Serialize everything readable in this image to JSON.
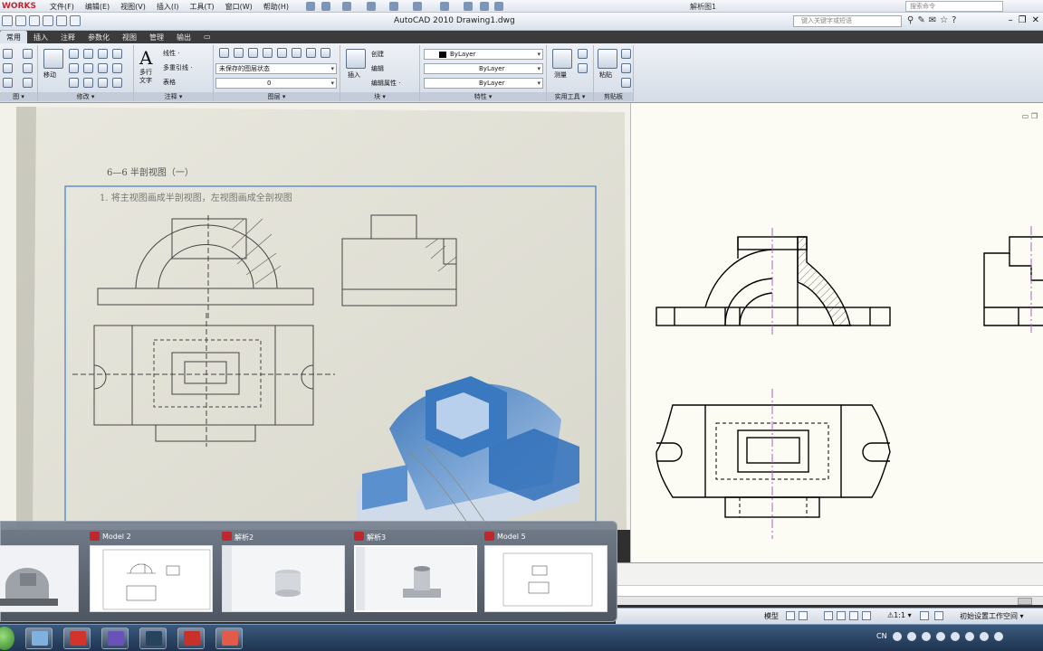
{
  "sw_menu": {
    "brand": "WORKS",
    "items": [
      "文件(F)",
      "编辑(E)",
      "视图(V)",
      "插入(I)",
      "工具(T)",
      "窗口(W)",
      "帮助(H)"
    ],
    "doc_title": "解析图1",
    "search_placeholder": "搜索命令"
  },
  "acad": {
    "title": "AutoCAD 2010    Drawing1.dwg",
    "search_placeholder": "键入关键字或短语"
  },
  "ribbon_tabs": [
    "常用",
    "插入",
    "注释",
    "参数化",
    "视图",
    "管理",
    "输出"
  ],
  "active_tab": "常用",
  "ribbon": {
    "panel_titles": [
      "图 ▾",
      "修改 ▾",
      "注释 ▾",
      "图层 ▾",
      "块 ▾",
      "特性 ▾",
      "实用工具 ▾",
      "剪贴板"
    ],
    "move_label": "移动",
    "multiline_text_label": "多行\n文字",
    "linear_label": "线性 ·",
    "multileader_label": "多重引线 ·",
    "table_label": "表格",
    "layer_state": "未保存的图层状态",
    "layer_current": "0",
    "insert_label": "插入",
    "create_label": "创建",
    "edit_label": "编辑",
    "edit_attr_label": "编辑属性 ·",
    "color_value": "ByLayer",
    "linetype_value": "ByLayer",
    "lineweight_value": "ByLayer",
    "measure_label": "测量",
    "paste_label": "粘贴"
  },
  "photo": {
    "heading": "6—6   半剖视图（一）",
    "task": "1. 将主视图画成半剖视图，左视图画成全剖视图"
  },
  "thumbnails": [
    {
      "title": "",
      "kind": "3d"
    },
    {
      "title": "Model 2",
      "kind": "drawing"
    },
    {
      "title": "解析2",
      "kind": "cylinder"
    },
    {
      "title": "解析3",
      "kind": "part"
    },
    {
      "title": "Model 5",
      "kind": "drawing"
    }
  ],
  "status": {
    "model_label": "模型",
    "scale_label": "⚠1:1 ▾",
    "workspace_label": "初始设置工作空间 ▾"
  },
  "tray": {
    "lang": "CN"
  },
  "colors": {
    "ribbon_dark": "#3b3b3b",
    "canvas_bg": "#fcfcf4",
    "center_line": "#b05fc4",
    "taskbar": "#1f3450",
    "brand_red": "#c3262e"
  }
}
